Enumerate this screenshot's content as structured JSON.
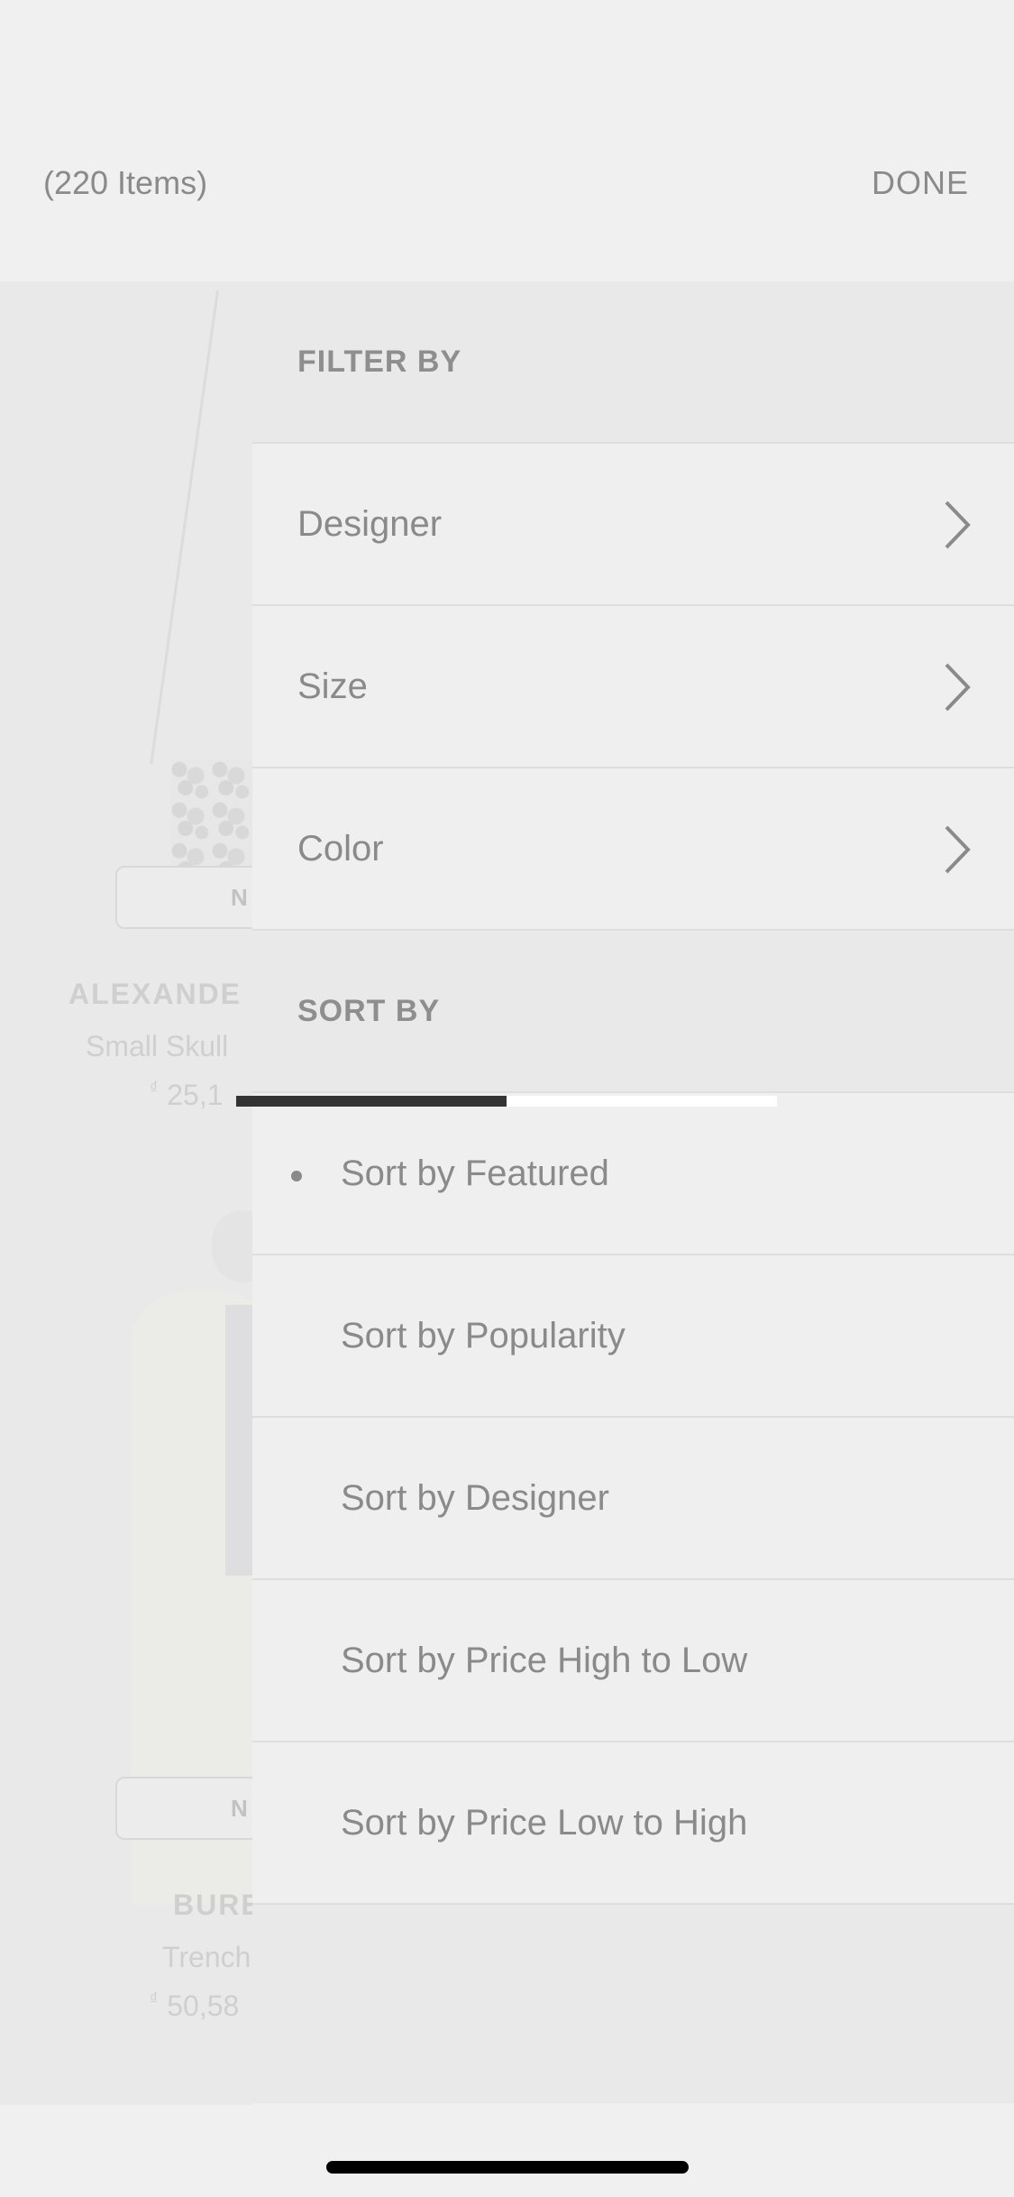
{
  "header": {
    "item_count": "(220 Items)",
    "done_label": "DONE"
  },
  "background_products": [
    {
      "badge": "N",
      "brand": "ALEXANDE",
      "name": "Small Skull",
      "currency": "₫",
      "price": "25,1"
    },
    {
      "badge": "N",
      "brand": "BURE",
      "name": "Trench",
      "currency": "₫",
      "price": "50,58"
    }
  ],
  "filter": {
    "header": "FILTER BY",
    "items": [
      {
        "label": "Designer",
        "icon": "chevron-right-icon"
      },
      {
        "label": "Size",
        "icon": "chevron-right-icon"
      },
      {
        "label": "Color",
        "icon": "chevron-right-icon"
      }
    ]
  },
  "sort": {
    "header": "SORT BY",
    "selected": "Sort by Featured",
    "items": [
      {
        "label": "Sort by Featured"
      },
      {
        "label": "Sort by Popularity"
      },
      {
        "label": "Sort by Designer"
      },
      {
        "label": "Sort by Price High to Low"
      },
      {
        "label": "Sort by Price Low to High"
      }
    ]
  },
  "loading": {
    "progress": 0.5
  },
  "colors": {
    "background": "#f0f0f0",
    "panel": "#efefef",
    "section_header": "#e9e9e9",
    "text": "#8a8a8a",
    "progress_fill": "#333333",
    "progress_track": "#ffffff"
  }
}
